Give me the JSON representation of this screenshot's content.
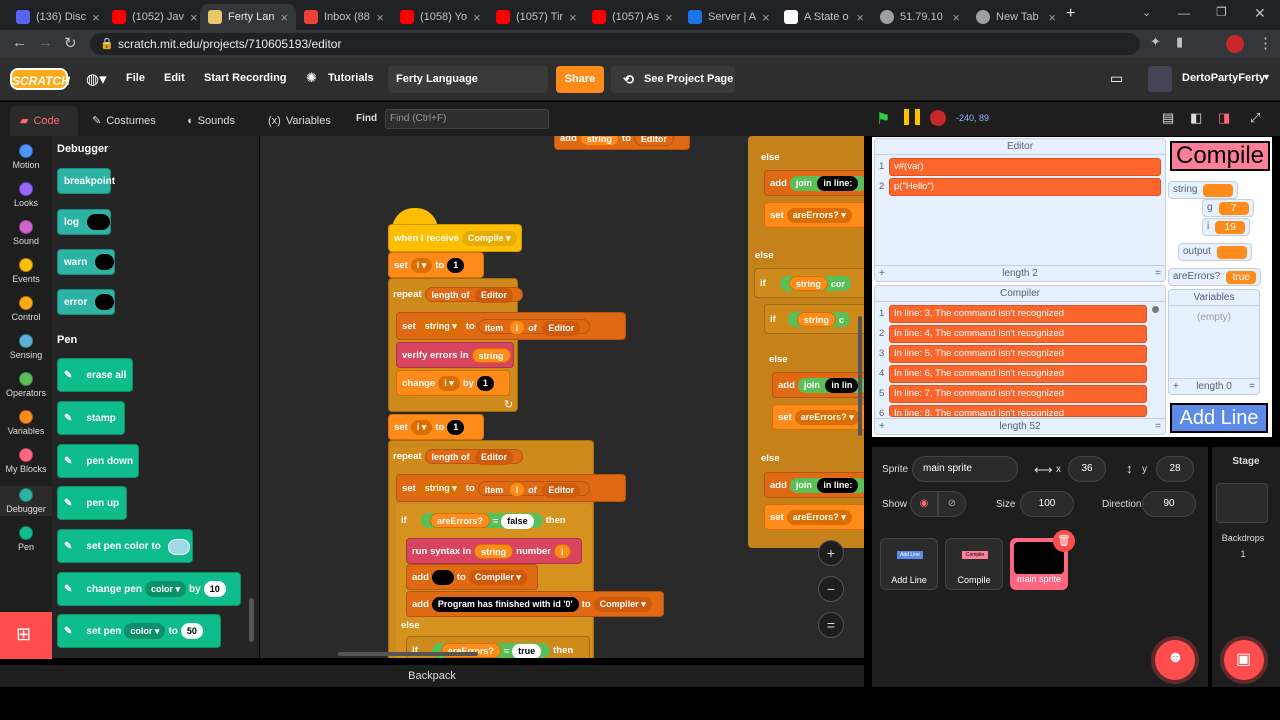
{
  "browser": {
    "tabs": [
      {
        "label": "(136) Disc",
        "color": "#5865f2"
      },
      {
        "label": "(1052) Jav",
        "color": "#ff0000"
      },
      {
        "label": "Ferty Lan",
        "color": "#e8c66a"
      },
      {
        "label": "Inbox (88",
        "color": "#ea4335"
      },
      {
        "label": "(1058) Yo",
        "color": "#ff0000"
      },
      {
        "label": "(1057) Tir",
        "color": "#ff0000"
      },
      {
        "label": "(1057) As",
        "color": "#ff0000"
      },
      {
        "label": "Server | A",
        "color": "#1a73e8"
      },
      {
        "label": "A State o",
        "color": "#ffffff"
      },
      {
        "label": "51.79.10",
        "color": "#9aa0a6"
      },
      {
        "label": "New Tab",
        "color": "#9aa0a6"
      }
    ],
    "url": "scratch.mit.edu/projects/710605193/editor"
  },
  "menubar": {
    "logo": "SCRATCH",
    "file": "File",
    "edit": "Edit",
    "start_recording": "Start Recording",
    "tutorials": "Tutorials",
    "project_title": "Ferty Language",
    "share": "Share",
    "see_project_page": "See Project Page",
    "username": "DertoPartyFerty"
  },
  "editor_tabs": {
    "code": "Code",
    "costumes": "Costumes",
    "sounds": "Sounds",
    "variables": "Variables",
    "find": "Find",
    "find_placeholder": "Find (Ctrl+F)"
  },
  "categories": [
    {
      "label": "Motion",
      "color": "#4c97ff"
    },
    {
      "label": "Looks",
      "color": "#9966ff"
    },
    {
      "label": "Sound",
      "color": "#cf63cf"
    },
    {
      "label": "Events",
      "color": "#ffbf00"
    },
    {
      "label": "Control",
      "color": "#ffab19"
    },
    {
      "label": "Sensing",
      "color": "#5cb1d6"
    },
    {
      "label": "Operators",
      "color": "#59c059"
    },
    {
      "label": "Variables",
      "color": "#ff8c1a"
    },
    {
      "label": "My Blocks",
      "color": "#ff6680"
    },
    {
      "label": "Debugger",
      "color": "#2db3a4"
    },
    {
      "label": "Pen",
      "color": "#0fbd8c"
    }
  ],
  "palette": {
    "debugger_heading": "Debugger",
    "breakpoint": "breakpoint",
    "log": "log",
    "warn": "warn",
    "error": "error",
    "pen_heading": "Pen",
    "erase_all": "erase all",
    "stamp": "stamp",
    "pen_down": "pen down",
    "pen_up": "pen up",
    "set_pen_color_to": "set pen color to",
    "change_pen": "change pen",
    "color": "color",
    "by": "by",
    "change_value": "10",
    "set_pen": "set pen",
    "to": "to",
    "set_value": "50"
  },
  "script": {
    "top_partial": {
      "add": "add",
      "string": "string",
      "to": "to",
      "list": "Editor"
    },
    "when_i_receive": "when I receive",
    "message": "Compile",
    "set": "set",
    "i": "i",
    "to": "to",
    "one": "1",
    "repeat": "repeat",
    "length_of": "length of",
    "editor": "Editor",
    "string": "string",
    "item": "item",
    "of": "of",
    "verify_errors_in": "verify errors in",
    "change": "change",
    "by": "by",
    "if": "if",
    "are_errors": "areErrors?",
    "equals": "=",
    "false": "false",
    "then": "then",
    "run_syntax_in": "run syntax in",
    "number": "number",
    "add": "add",
    "compiler": "Compiler",
    "finished_msg": "Program has finished with id '0'",
    "else": "else",
    "true": "true"
  },
  "script_right": {
    "else1": "else",
    "add": "add",
    "join": "join",
    "in_line": "in line:",
    "set": "set",
    "are_errors": "areErrors?",
    "else2": "else",
    "if": "if",
    "string": "string",
    "cor": "cor",
    "c": "c",
    "else3": "else",
    "in_lin": "in lin",
    "else4": "else"
  },
  "zoom": {
    "in": "+",
    "out": "−",
    "reset": "="
  },
  "backpack": "Backpack",
  "stage_header": {
    "coords": "-240, 89"
  },
  "stage": {
    "editor_list": {
      "title": "Editor",
      "items": [
        "v#(var)",
        "p(\"Hello\")"
      ],
      "length": "length 2",
      "add": "+",
      "eq": "="
    },
    "compile_label": "Compile",
    "var_string": {
      "label": "string",
      "value": ""
    },
    "var_g": {
      "label": "g",
      "value": "7"
    },
    "var_i": {
      "label": "i",
      "value": "19"
    },
    "var_output": {
      "label": "output",
      "value": ""
    },
    "var_areerrors": {
      "label": "areErrors?",
      "value": "true"
    },
    "compiler_list": {
      "title": "Compiler",
      "items": [
        "In line: 3, The command isn't recognized",
        "In line: 4, The command isn't recognized",
        "In line: 5, The command isn't recognized",
        "In line: 6, The command isn't recognized",
        "In line: 7, The command isn't recognized",
        "In line: 8, The command isn't recognized"
      ],
      "length": "length 52",
      "add": "+",
      "eq": "="
    },
    "variables_list": {
      "title": "Variables",
      "empty": "(empty)",
      "length": "length 0",
      "add": "+",
      "eq": "="
    },
    "add_line_label": "Add Line"
  },
  "sprite_info": {
    "sprite_label": "Sprite",
    "sprite_name": "main sprite",
    "x_label": "x",
    "x_value": "36",
    "y_label": "y",
    "y_value": "28",
    "show_label": "Show",
    "size_label": "Size",
    "size_value": "100",
    "direction_label": "Direction",
    "direction_value": "90",
    "sprites": [
      {
        "name": "Add Line",
        "thumb": "Add Line"
      },
      {
        "name": "Compile",
        "thumb": "Compile"
      },
      {
        "name": "main sprite",
        "thumb": ""
      }
    ]
  },
  "stage_panel": {
    "title": "Stage",
    "backdrops_label": "Backdrops",
    "backdrops_count": "1"
  }
}
